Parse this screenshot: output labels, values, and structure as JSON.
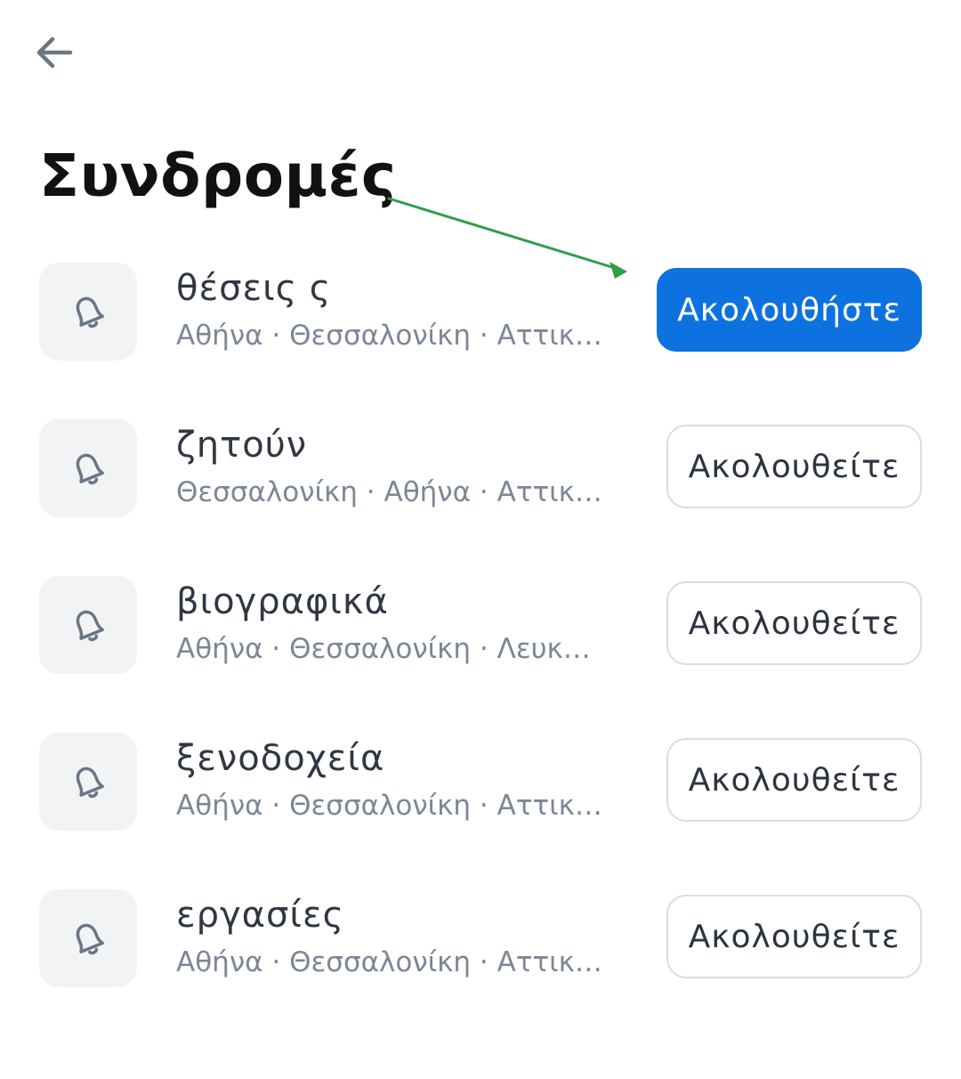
{
  "header": {
    "back_icon": "arrow-left-icon",
    "title": "Συνδρομές"
  },
  "subscriptions": [
    {
      "title": "θέσεις ς",
      "locations": "Αθήνα · Θεσσαλονίκη · Αττική ·…",
      "button_label": "Ακολουθήστε",
      "following": false
    },
    {
      "title": "ζητούν",
      "locations": "Θεσσαλονίκη · Αθήνα · Αττική ·…",
      "button_label": "Ακολουθείτε",
      "following": true
    },
    {
      "title": "βιογραφικά",
      "locations": "Αθήνα · Θεσσαλονίκη · Λευκωσ…",
      "button_label": "Ακολουθείτε",
      "following": true
    },
    {
      "title": "ξενοδοχεία",
      "locations": "Αθήνα · Θεσσαλονίκη · Αττική ·…",
      "button_label": "Ακολουθείτε",
      "following": true
    },
    {
      "title": "εργασίες",
      "locations": "Αθήνα · Θεσσαλονίκη · Αττική ·…",
      "button_label": "Ακολουθείτε",
      "following": true
    }
  ],
  "icons": {
    "row_icon": "bell-icon"
  },
  "colors": {
    "primary": "#0d72e0",
    "annotation_arrow": "#2f9e4a",
    "tile_background": "#f2f3f5",
    "subtitle": "#7c8796"
  }
}
